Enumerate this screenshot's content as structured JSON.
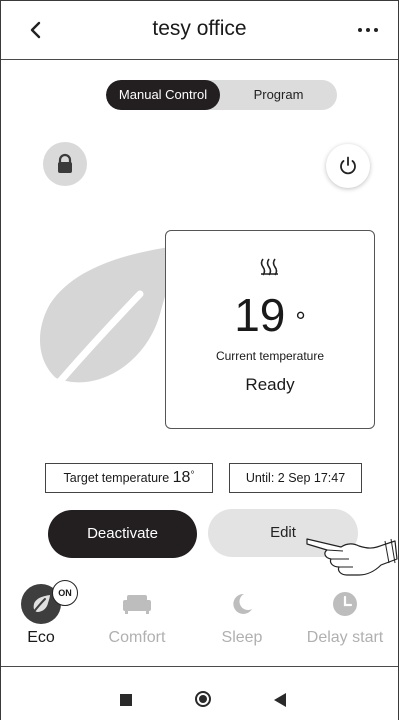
{
  "header": {
    "title": "tesy office",
    "back_icon": "chevron-left-icon",
    "menu_icon": "more-horizontal-icon"
  },
  "mode_switch": {
    "options": [
      "Manual Control",
      "Program"
    ],
    "selected": "Manual Control"
  },
  "controls": {
    "lock_icon": "lock-icon",
    "power_icon": "power-icon"
  },
  "temperature_card": {
    "heating_icon": "heat-waves-icon",
    "current_value": "19",
    "unit": "°",
    "current_label": "Current temperature",
    "status": "Ready"
  },
  "target": {
    "label": "Target temperature",
    "value": "18",
    "unit": "°"
  },
  "until": {
    "text": "Until: 2 Sep 17:47"
  },
  "actions": {
    "deactivate_label": "Deactivate",
    "edit_label": "Edit"
  },
  "modes": [
    {
      "label": "Eco",
      "icon": "leaf-icon",
      "badge": "ON",
      "active": true
    },
    {
      "label": "Comfort",
      "icon": "sofa-icon",
      "active": false
    },
    {
      "label": "Sleep",
      "icon": "moon-icon",
      "active": false
    },
    {
      "label": "Delay start",
      "icon": "clock-icon",
      "active": false
    }
  ],
  "colors": {
    "dark": "#231f20",
    "inactive_gray": "#b0b0b0",
    "light_gray": "#e3e3e3",
    "leaf_gray": "#d6d6d6"
  },
  "system_nav": [
    "recents-square-icon",
    "home-circle-icon",
    "back-triangle-icon"
  ]
}
